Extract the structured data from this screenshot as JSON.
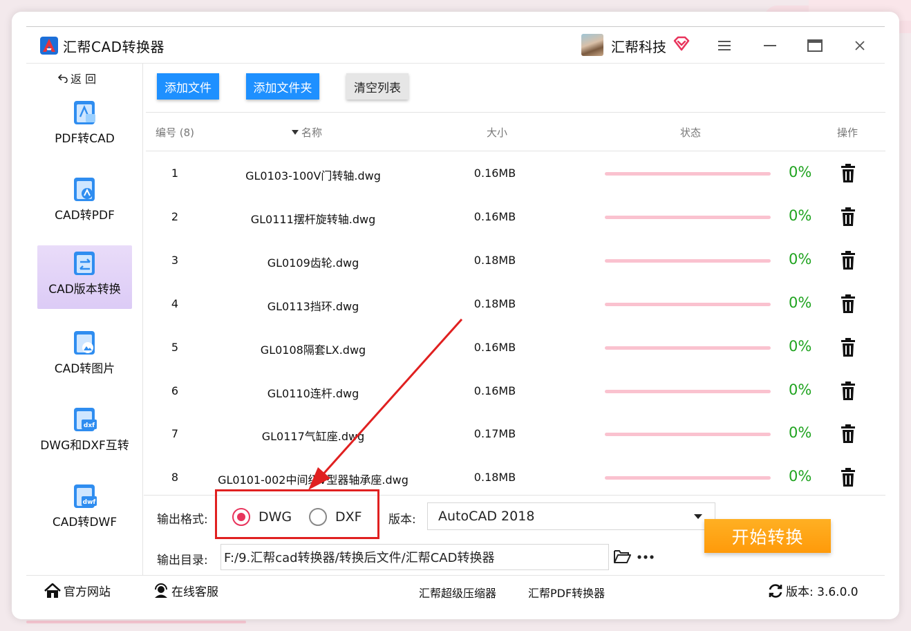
{
  "app": {
    "title": "汇帮CAD转换器",
    "user_name": "汇帮科技"
  },
  "sidebar": {
    "back_label": "返 回",
    "items": [
      {
        "label": "PDF转CAD",
        "active": false
      },
      {
        "label": "CAD转PDF",
        "active": false
      },
      {
        "label": "CAD版本转换",
        "active": true
      },
      {
        "label": "CAD转图片",
        "active": false
      },
      {
        "label": "DWG和DXF互转",
        "active": false
      },
      {
        "label": "CAD转DWF",
        "active": false
      }
    ]
  },
  "toolbar": {
    "add_file": "添加文件",
    "add_folder": "添加文件夹",
    "clear_list": "清空列表"
  },
  "table": {
    "headers": {
      "number": "编号 (8)",
      "name": "名称",
      "size": "大小",
      "status": "状态",
      "action": "操作"
    },
    "rows": [
      {
        "num": "1",
        "name": "GL0103-100V门转轴.dwg",
        "size": "0.16MB",
        "percent": "0%",
        "progress": 0
      },
      {
        "num": "2",
        "name": "GL0111摆杆旋转轴.dwg",
        "size": "0.16MB",
        "percent": "0%",
        "progress": 0
      },
      {
        "num": "3",
        "name": "GL0109齿轮.dwg",
        "size": "0.18MB",
        "percent": "0%",
        "progress": 0
      },
      {
        "num": "4",
        "name": "GL0113挡环.dwg",
        "size": "0.18MB",
        "percent": "0%",
        "progress": 0
      },
      {
        "num": "5",
        "name": "GL0108隔套LX.dwg",
        "size": "0.16MB",
        "percent": "0%",
        "progress": 0
      },
      {
        "num": "6",
        "name": "GL0110连杆.dwg",
        "size": "0.16MB",
        "percent": "0%",
        "progress": 0
      },
      {
        "num": "7",
        "name": "GL0117气缸座.dwg",
        "size": "0.17MB",
        "percent": "0%",
        "progress": 0
      },
      {
        "num": "8",
        "name": "GL0101-002中间级V型器轴承座.dwg",
        "size": "0.18MB",
        "percent": "0%",
        "progress": 0
      }
    ]
  },
  "output": {
    "format_label": "输出格式:",
    "formats": [
      {
        "label": "DWG",
        "selected": true
      },
      {
        "label": "DXF",
        "selected": false
      }
    ],
    "version_label": "版本:",
    "version_value": "AutoCAD 2018",
    "dir_label": "输出目录:",
    "dir_value": "F:/9.汇帮cad转换器/转换后文件/汇帮CAD转换器",
    "start_button": "开始转换"
  },
  "footer": {
    "official_site": "官方网站",
    "online_service": "在线客服",
    "compressor": "汇帮超级压缩器",
    "pdf_converter": "汇帮PDF转换器",
    "version": "版本: 3.6.0.0"
  },
  "colors": {
    "accent_blue": "#1e90ff",
    "start_orange": "#ff9a0a",
    "radio_red": "#e8345c",
    "percent_green": "#1fa31f",
    "progress_track": "#fac2cf",
    "annotation_red": "#e02020"
  }
}
